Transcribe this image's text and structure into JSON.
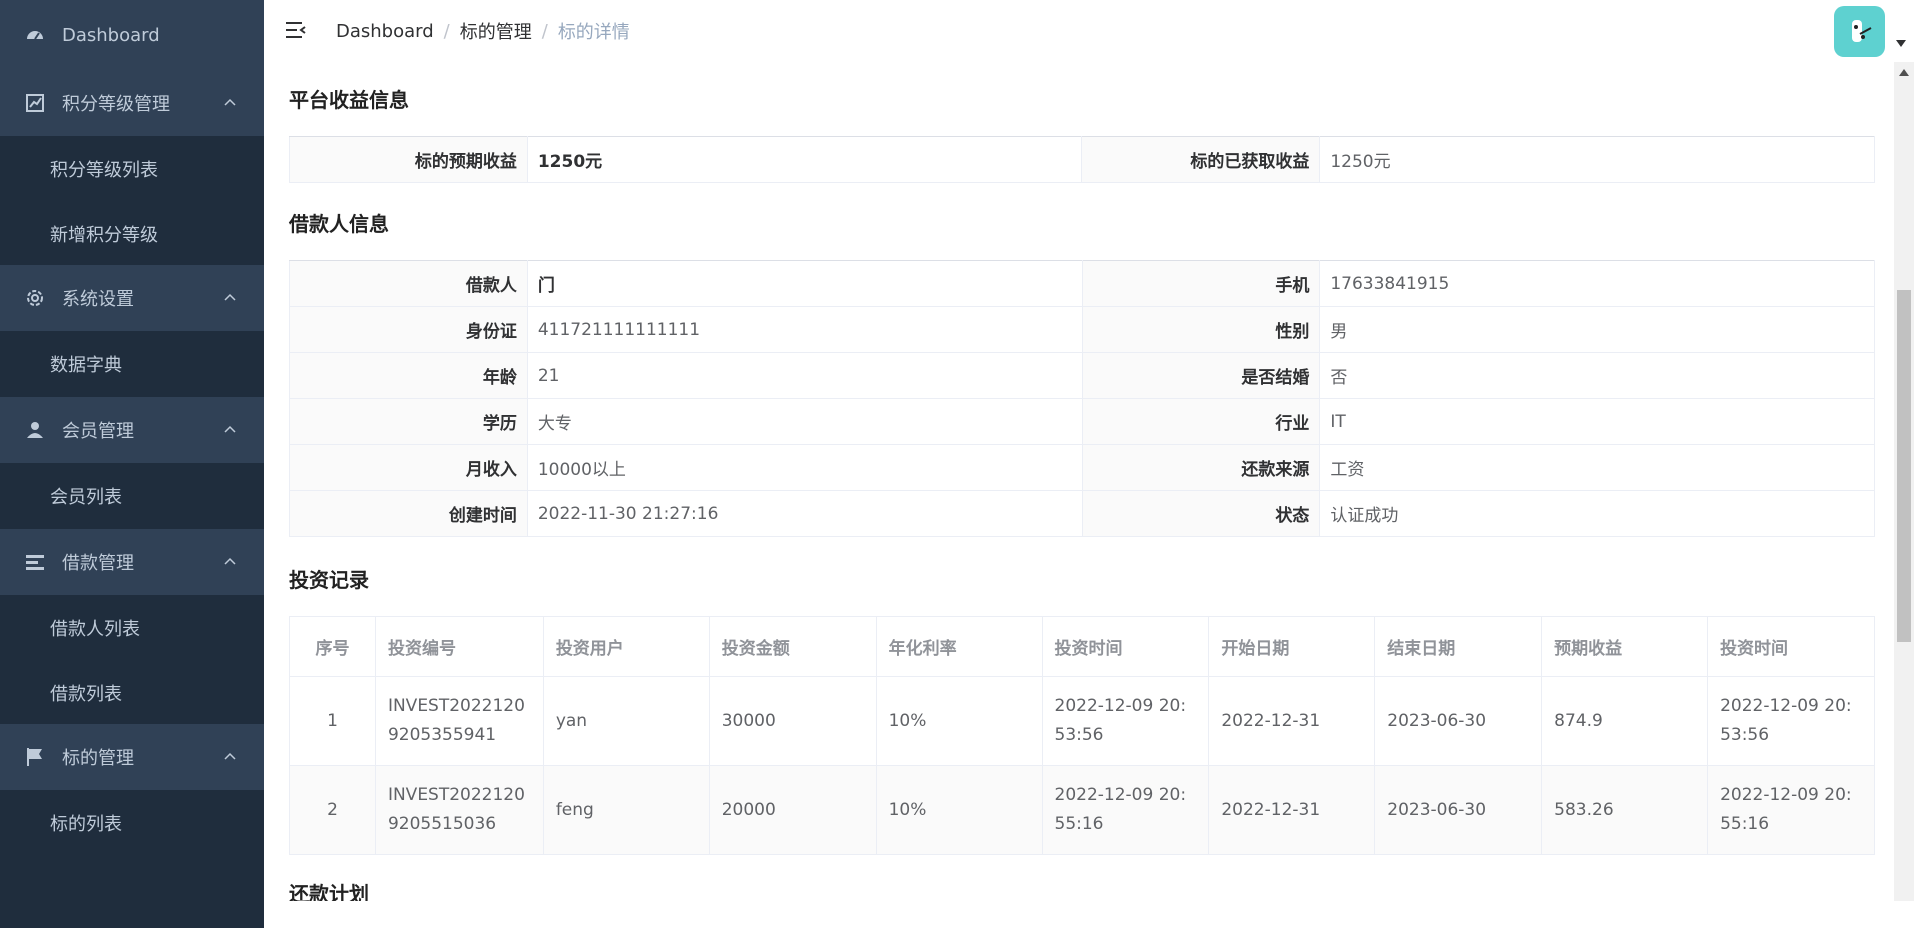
{
  "sidebar": {
    "items": [
      {
        "label": "Dashboard",
        "icon": "dashboard-icon"
      },
      {
        "label": "积分等级管理",
        "icon": "chart-icon",
        "children": [
          "积分等级列表",
          "新增积分等级"
        ]
      },
      {
        "label": "系统设置",
        "icon": "gear-icon",
        "children": [
          "数据字典"
        ]
      },
      {
        "label": "会员管理",
        "icon": "user-icon",
        "children": [
          "会员列表"
        ]
      },
      {
        "label": "借款管理",
        "icon": "list-icon",
        "children": [
          "借款人列表",
          "借款列表"
        ]
      },
      {
        "label": "标的管理",
        "icon": "flag-icon",
        "children": [
          "标的列表"
        ]
      }
    ]
  },
  "header": {
    "breadcrumb": [
      "Dashboard",
      "标的管理",
      "标的详情"
    ],
    "breadcrumb_separator": "/"
  },
  "profit": {
    "title": "平台收益信息",
    "expected_label": "标的预期收益",
    "expected_value": "1250元",
    "obtained_label": "标的已获取收益",
    "obtained_value": "1250元"
  },
  "borrower": {
    "title": "借款人信息",
    "rows": [
      [
        "借款人",
        "门",
        "手机",
        "17633841915"
      ],
      [
        "身份证",
        "411721111111111",
        "性别",
        "男"
      ],
      [
        "年龄",
        "21",
        "是否结婚",
        "否"
      ],
      [
        "学历",
        "大专",
        "行业",
        "IT"
      ],
      [
        "月收入",
        "10000以上",
        "还款来源",
        "工资"
      ],
      [
        "创建时间",
        "2022-11-30 21:27:16",
        "状态",
        "认证成功"
      ]
    ]
  },
  "invest": {
    "title": "投资记录",
    "columns": [
      "序号",
      "投资编号",
      "投资用户",
      "投资金额",
      "年化利率",
      "投资时间",
      "开始日期",
      "结束日期",
      "预期收益",
      "投资时间"
    ],
    "rows": [
      [
        "1",
        "INVEST20221209205355941",
        "yan",
        "30000",
        "10%",
        "2022-12-09 20:53:56",
        "2022-12-31",
        "2023-06-30",
        "874.9",
        "2022-12-09 20:53:56"
      ],
      [
        "2",
        "INVEST20221209205515036",
        "feng",
        "20000",
        "10%",
        "2022-12-09 20:55:16",
        "2022-12-31",
        "2023-06-30",
        "583.26",
        "2022-12-09 20:55:16"
      ]
    ]
  },
  "repay": {
    "title": "还款计划"
  },
  "colors": {
    "sidebar_bg": "#304156",
    "submenu_bg": "#1f2d3d",
    "sidebar_text": "#bfcbd9",
    "avatar_bg": "#5ed1d0"
  }
}
